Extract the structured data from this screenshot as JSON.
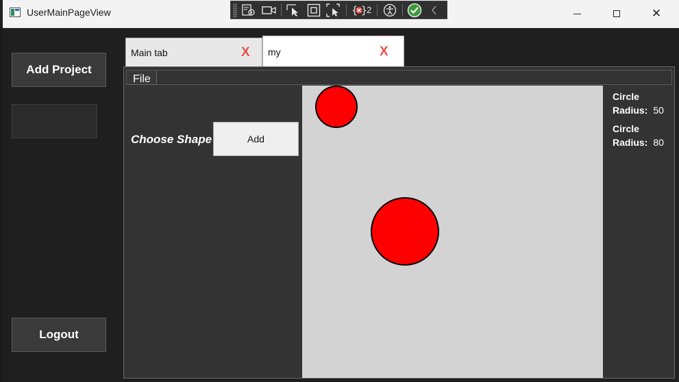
{
  "window": {
    "title": "UserMainPageView"
  },
  "debug_toolbar": {
    "error_count": "2"
  },
  "sidebar": {
    "add_project_label": "Add Project",
    "logout_label": "Logout"
  },
  "tabs": [
    {
      "label": "Main tab",
      "close": "X"
    },
    {
      "label": "my",
      "close": "X",
      "active": true
    }
  ],
  "menu": {
    "file_label": "File"
  },
  "controls": {
    "choose_shape_label": "Choose Shape",
    "add_label": "Add"
  },
  "canvas": {
    "shapes": [
      {
        "type": "Circle",
        "radius": 50,
        "color": "#ff0000"
      },
      {
        "type": "Circle",
        "radius": 80,
        "color": "#ff0000"
      }
    ]
  },
  "shape_list": [
    {
      "name": "Circle",
      "radius_label": "Radius:",
      "radius_value": "50"
    },
    {
      "name": "Circle",
      "radius_label": "Radius:",
      "radius_value": "80"
    }
  ],
  "colors": {
    "accent_close": "#e8524a",
    "shape_fill": "#ff0000",
    "canvas_bg": "#d3d3d3"
  }
}
